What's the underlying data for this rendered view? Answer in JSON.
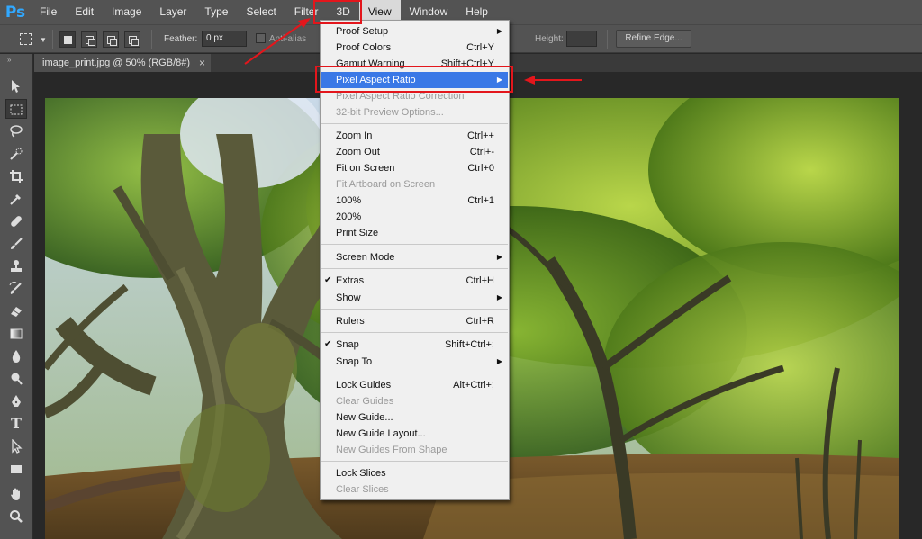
{
  "app": {
    "logo": "Ps"
  },
  "menubar": {
    "items": [
      "File",
      "Edit",
      "Image",
      "Layer",
      "Type",
      "Select",
      "Filter",
      "3D",
      "View",
      "Window",
      "Help"
    ],
    "active": "View"
  },
  "options": {
    "feather_label": "Feather:",
    "feather_value": "0 px",
    "antialias_label": "Anti-alias",
    "height_label": "Height:",
    "refine_label": "Refine Edge..."
  },
  "document": {
    "tab_title": "image_print.jpg @ 50% (RGB/8#)",
    "close_glyph": "×"
  },
  "view_menu": {
    "items": [
      {
        "label": "Proof Setup",
        "shortcut": "",
        "submenu": true,
        "disabled": false
      },
      {
        "label": "Proof Colors",
        "shortcut": "Ctrl+Y",
        "submenu": false,
        "disabled": false
      },
      {
        "label": "Gamut Warning",
        "shortcut": "Shift+Ctrl+Y",
        "submenu": false,
        "disabled": false
      },
      {
        "label": "Pixel Aspect Ratio",
        "shortcut": "",
        "submenu": true,
        "disabled": false,
        "highlighted": true
      },
      {
        "label": "Pixel Aspect Ratio Correction",
        "shortcut": "",
        "submenu": false,
        "disabled": true
      },
      {
        "label": "32-bit Preview Options...",
        "shortcut": "",
        "submenu": false,
        "disabled": true
      },
      {
        "label": "Zoom In",
        "shortcut": "Ctrl++",
        "submenu": false,
        "disabled": false
      },
      {
        "label": "Zoom Out",
        "shortcut": "Ctrl+-",
        "submenu": false,
        "disabled": false
      },
      {
        "label": "Fit on Screen",
        "shortcut": "Ctrl+0",
        "submenu": false,
        "disabled": false
      },
      {
        "label": "Fit Artboard on Screen",
        "shortcut": "",
        "submenu": false,
        "disabled": true
      },
      {
        "label": "100%",
        "shortcut": "Ctrl+1",
        "submenu": false,
        "disabled": false
      },
      {
        "label": "200%",
        "shortcut": "",
        "submenu": false,
        "disabled": false
      },
      {
        "label": "Print Size",
        "shortcut": "",
        "submenu": false,
        "disabled": false
      },
      {
        "label": "Screen Mode",
        "shortcut": "",
        "submenu": true,
        "disabled": false
      },
      {
        "label": "Extras",
        "shortcut": "Ctrl+H",
        "submenu": false,
        "disabled": false,
        "checked": true
      },
      {
        "label": "Show",
        "shortcut": "",
        "submenu": true,
        "disabled": false
      },
      {
        "label": "Rulers",
        "shortcut": "Ctrl+R",
        "submenu": false,
        "disabled": false
      },
      {
        "label": "Snap",
        "shortcut": "Shift+Ctrl+;",
        "submenu": false,
        "disabled": false,
        "checked": true
      },
      {
        "label": "Snap To",
        "shortcut": "",
        "submenu": true,
        "disabled": false
      },
      {
        "label": "Lock Guides",
        "shortcut": "Alt+Ctrl+;",
        "submenu": false,
        "disabled": false
      },
      {
        "label": "Clear Guides",
        "shortcut": "",
        "submenu": false,
        "disabled": true
      },
      {
        "label": "New Guide...",
        "shortcut": "",
        "submenu": false,
        "disabled": false
      },
      {
        "label": "New Guide Layout...",
        "shortcut": "",
        "submenu": false,
        "disabled": false
      },
      {
        "label": "New Guides From Shape",
        "shortcut": "",
        "submenu": false,
        "disabled": true
      },
      {
        "label": "Lock Slices",
        "shortcut": "",
        "submenu": false,
        "disabled": false
      },
      {
        "label": "Clear Slices",
        "shortcut": "",
        "submenu": false,
        "disabled": true
      }
    ]
  },
  "colors": {
    "accent_highlight": "#3a78e6",
    "annotation_red": "#e3161c",
    "ps_blue": "#31a8ff"
  },
  "toolbar_icons": [
    "move-icon",
    "marquee-icon",
    "lasso-icon",
    "quick-select-icon",
    "crop-icon",
    "eyedropper-icon",
    "healing-brush-icon",
    "brush-icon",
    "clone-stamp-icon",
    "history-brush-icon",
    "eraser-icon",
    "gradient-icon",
    "blur-icon",
    "dodge-icon",
    "pen-icon",
    "type-icon",
    "path-select-icon",
    "rectangle-icon",
    "hand-icon",
    "zoom-icon"
  ]
}
